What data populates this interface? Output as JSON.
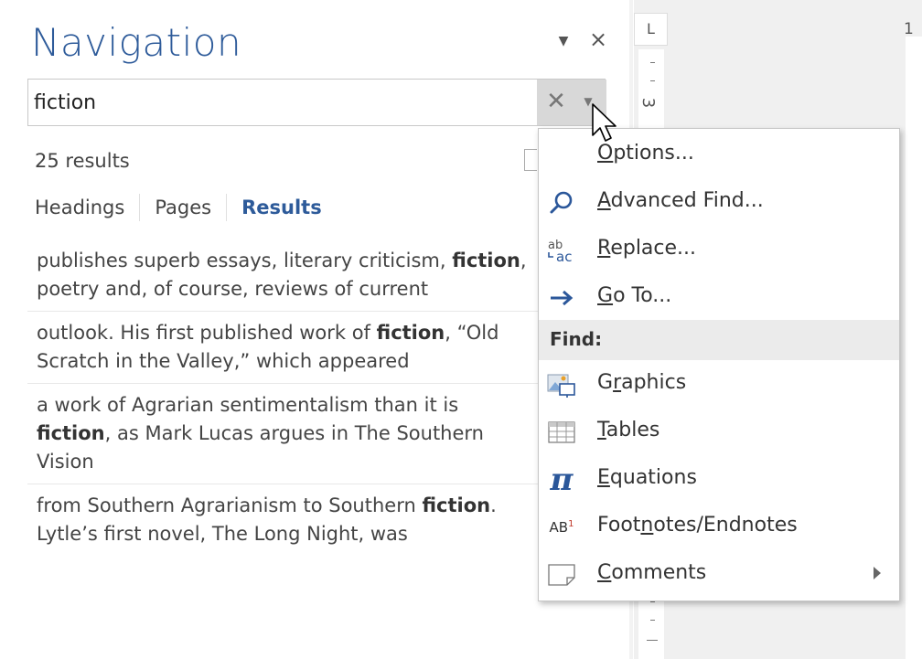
{
  "nav": {
    "title": "Navigation",
    "search_value": "fiction",
    "results_count": "25 results",
    "tabs": [
      {
        "label": "Headings"
      },
      {
        "label": "Pages"
      },
      {
        "label": "Results"
      }
    ],
    "results": [
      {
        "before": "publishes superb essays, literary criticism,",
        "highlight": "fiction",
        "after": ", poetry and, of course, reviews of current"
      },
      {
        "before": "outlook.  His first published work of",
        "highlight": "fiction",
        "after": ", “Old Scratch in the Valley,” which appeared"
      },
      {
        "before": "a work of Agrarian sentimentalism than it is",
        "highlight": "fiction",
        "after": ", as Mark Lucas argues in The Southern Vision"
      },
      {
        "before": "from Southern Agrarianism to Southern",
        "highlight": "fiction",
        "after": ". Lytle’s first novel, The Long Night, was"
      }
    ]
  },
  "ruler": {
    "tab_glyph": "L",
    "number": "3"
  },
  "doc": {
    "page_number": "1"
  },
  "menu": {
    "options": {
      "pre": "",
      "key": "O",
      "post": "ptions..."
    },
    "advanced_find": {
      "pre": "",
      "key": "A",
      "post": "dvanced Find..."
    },
    "replace": {
      "pre": "",
      "key": "R",
      "post": "eplace..."
    },
    "goto": {
      "pre": "",
      "key": "G",
      "post": "o To..."
    },
    "find_header": "Find:",
    "graphics": {
      "pre": "G",
      "key": "r",
      "post": "aphics"
    },
    "tables": {
      "pre": "",
      "key": "T",
      "post": "ables"
    },
    "equations": {
      "pre": "",
      "key": "E",
      "post": "quations"
    },
    "footnotes": {
      "pre": "Foot",
      "key": "n",
      "post": "otes/Endnotes"
    },
    "comments": {
      "pre": "",
      "key": "C",
      "post": "omments"
    }
  },
  "colors": {
    "accent": "#2e5b9a",
    "icon_blue": "#2b579a"
  }
}
